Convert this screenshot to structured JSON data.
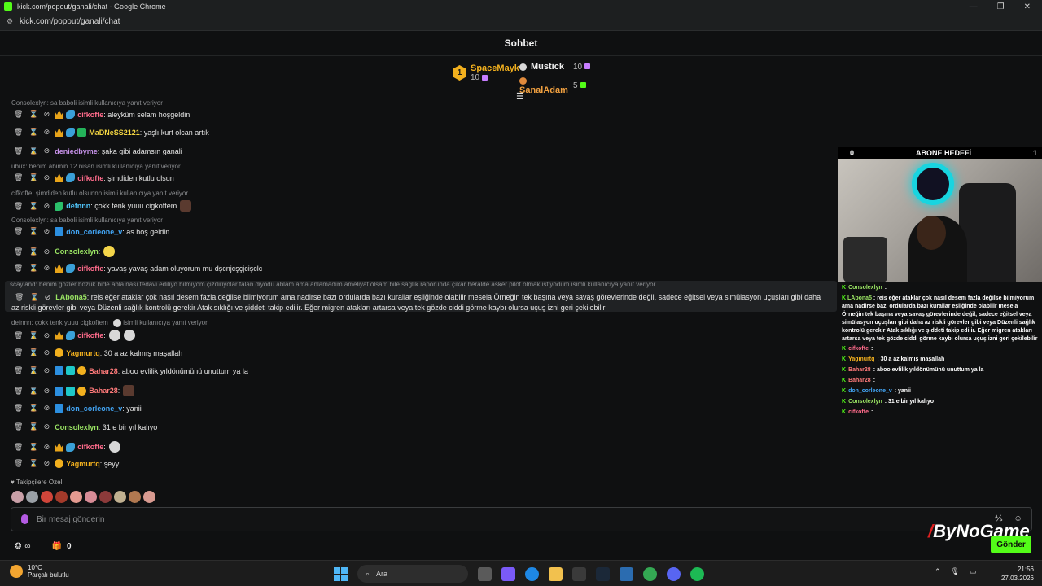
{
  "window": {
    "title": "kick.com/popout/ganali/chat - Google Chrome",
    "url": "kick.com/popout/ganali/chat"
  },
  "chat": {
    "title": "Sohbet",
    "input_placeholder": "Bir mesaj gönderin",
    "send_label": "Gönder",
    "followers_label": "Takipçilere Özel",
    "points": "0"
  },
  "leaderboard": {
    "first": {
      "rank": "1",
      "name": "SpaceMayk",
      "count": "10"
    },
    "others": [
      {
        "name": "Mustick",
        "count": "10"
      },
      {
        "name": "SanalAdam",
        "count": "5"
      }
    ]
  },
  "messages": [
    {
      "reply": "Consolexlyn: sa baboli isimli kullanıcıya yanıt veriyor",
      "user": "cifkofte",
      "text": ": aleyküm selam hoşgeldin"
    },
    {
      "user": "MaDNeSS2121",
      "text": ": yaşlı kurt olcan artık"
    },
    {
      "user": "deniedbyme",
      "text": ": şaka gibi adamsın ganali"
    },
    {
      "reply": "ubux: benim abimin 12 nisan isimli kullanıcıya yanıt veriyor",
      "user": "cifkofte",
      "text": ": şimdiden kutlu olsun"
    },
    {
      "reply": "cifkofte: şimdiden kutlu olsunnn isimli kullanıcıya yanıt veriyor",
      "user": "defnnn",
      "text": ": çokk tenk yuuu cigkoftem"
    },
    {
      "reply": "Consolexlyn: sa baboli isimli kullanıcıya yanıt veriyor",
      "user": "don_corleone_v",
      "text": ": as hoş geldin"
    },
    {
      "user": "Consolexlyn",
      "text": ":"
    },
    {
      "user": "cifkofte",
      "text": ": yavaş yavaş adam oluyorum mu dşcnjcşçjcişclc"
    },
    {
      "reply": "scayland: benim gözler bozuk bide abla nası tedavi ediliyo bilmiyom çizdiriyolar falan diyodu ablam ama anlamadım ameliyat olsam bile sağlık raporunda çıkar heralde asker pilot olmak istiyodum isimli kullanıcıya yanıt veriyor",
      "user": "LAbona5",
      "text": ": reis eğer ataklar çok nasıl desem fazla değilse bilmiyorum ama nadirse bazı ordularda bazı kurallar eşliğinde olabilir mesela Örneğin tek başına veya savaş görevlerinde değil, sadece eğitsel veya simülasyon uçuşları gibi daha az riskli görevler gibi veya Düzenli sağlık kontrolü gerekir Atak sıklığı ve şiddeti takip edilir. Eğer migren atakları artarsa veya tek gözde ciddi görme kaybı olursa uçuş izni geri çekilebilir"
    },
    {
      "reply": "defnnn: çokk tenk yuuu cigkoftem",
      "reply_tail": "isimli kullanıcıya yanıt veriyor",
      "user": "cifkofte",
      "text": ":"
    },
    {
      "user": "Yagmurtq",
      "text": ": 30 a az kalmış maşallah"
    },
    {
      "user": "Bahar28",
      "text": ": aboo evlilik yıldönümünü unuttum ya la"
    },
    {
      "user": "Bahar28",
      "text": ":"
    },
    {
      "user": "don_corleone_v",
      "text": ": yanii"
    },
    {
      "user": "Consolexlyn",
      "text": ": 31 e bir yıl kalıyo"
    },
    {
      "user": "cifkofte",
      "text": ":"
    },
    {
      "user": "Yagmurtq",
      "text": ": şeyy"
    }
  ],
  "overlay": {
    "goal_title": "ABONE HEDEFİ",
    "goal_left": "0",
    "goal_right": "1",
    "lines": [
      {
        "user": "Consolexlyn",
        "text": " : "
      },
      {
        "user": "LAbona5",
        "text": " : reis eğer ataklar çok nasıl desem fazla değilse bilmiyorum ama nadirse bazı ordularda bazı kurallar eşliğinde olabilir mesela Örneğin tek başına veya savaş görevlerinde değil, sadece eğitsel veya simülasyon uçuşları gibi daha az riskli görevler gibi veya Düzenli sağlık kontrolü gerekir Atak sıklığı ve şiddeti takip edilir. Eğer migren atakları artarsa veya tek gözde ciddi görme kaybı olursa uçuş izni geri çekilebilir"
      },
      {
        "user": "cifkofte",
        "text": " : "
      },
      {
        "user": "Yagmurtq",
        "text": " : 30 a az kalmış maşallah"
      },
      {
        "user": "Bahar28",
        "text": " : aboo evlilik yıldönümünü unuttum ya la"
      },
      {
        "user": "Bahar28",
        "text": " : "
      },
      {
        "user": "don_corleone_v",
        "text": " : yanii"
      },
      {
        "user": "Consolexlyn",
        "text": " : 31 e bir yıl kalıyo"
      },
      {
        "user": "cifkofte",
        "text": " : "
      }
    ],
    "brand": "ByNoGame"
  },
  "taskbar": {
    "temp": "10°C",
    "weather": "Parçalı bulutlu",
    "search": "Ara",
    "time": "21:56",
    "date": "27.03.2026"
  },
  "colors": {
    "accent": "#53fc18",
    "bg": "#0f1011"
  }
}
